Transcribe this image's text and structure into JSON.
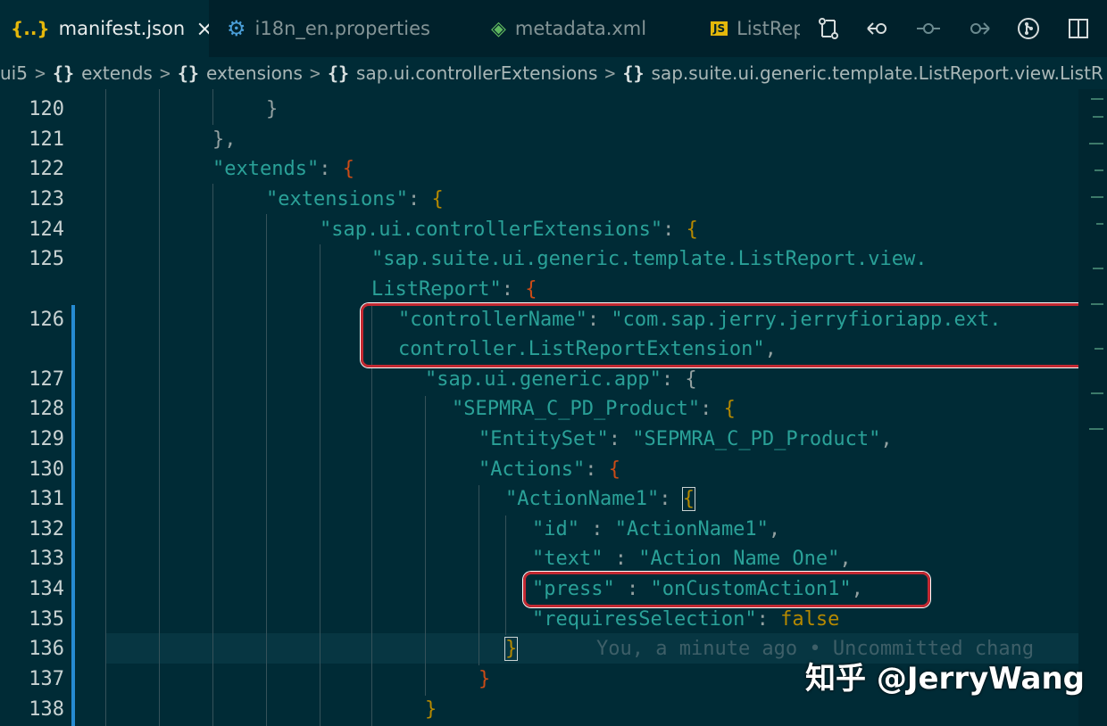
{
  "tabs": [
    {
      "icon": "{..}",
      "label": "manifest.json",
      "close": "×",
      "active": true
    },
    {
      "icon": "⚙",
      "label": "i18n_en.properties"
    },
    {
      "icon": "◈",
      "label": "metadata.xml"
    },
    {
      "icon": "JS",
      "label": "ListRep"
    }
  ],
  "breadcrumb": [
    {
      "label": "ui5"
    },
    {
      "label": "extends"
    },
    {
      "label": "extensions"
    },
    {
      "label": "sap.ui.controllerExtensions"
    },
    {
      "label": "sap.suite.ui.generic.template.ListReport.view.ListR"
    }
  ],
  "line_numbers": [
    "120",
    "121",
    "122",
    "123",
    "124",
    "125",
    "126",
    "127",
    "128",
    "129",
    "130",
    "131",
    "132",
    "133",
    "134",
    "135",
    "136",
    "137",
    "138"
  ],
  "code": {
    "l120": "}",
    "l121": "},",
    "l122_key": "\"extends\"",
    "l123_key": "\"extensions\"",
    "l124_key": "\"sap.ui.controllerExtensions\"",
    "l125a_key": "\"sap.suite.ui.generic.template.ListReport.view.",
    "l125b_key": "ListReport\"",
    "l126a_key": "\"controllerName\"",
    "l126a_val": "\"com.sap.jerry.jerryfioriapp.ext.",
    "l126b_val": "controller.ListReportExtension\"",
    "l127_key": "\"sap.ui.generic.app\"",
    "l128_key": "\"SEPMRA_C_PD_Product\"",
    "l129_key": "\"EntitySet\"",
    "l129_val": "\"SEPMRA_C_PD_Product\"",
    "l130_key": "\"Actions\"",
    "l131_key": "\"ActionName1\"",
    "l132_key": "\"id\"",
    "l132_val": "\"ActionName1\"",
    "l133_key": "\"text\"",
    "l133_val": "\"Action Name One\"",
    "l134_key": "\"press\"",
    "l134_val": "\"onCustomAction1\"",
    "l135_key": "\"requiresSelection\"",
    "l135_val": "false",
    "l136": "}",
    "l137": "}",
    "l138": "}"
  },
  "blame": "You, a minute ago • Uncommitted chang",
  "watermark": "知乎 @JerryWang",
  "colors": {
    "accent": "#2aa198",
    "highlight_box": "#c22932",
    "background": "#002b36"
  }
}
